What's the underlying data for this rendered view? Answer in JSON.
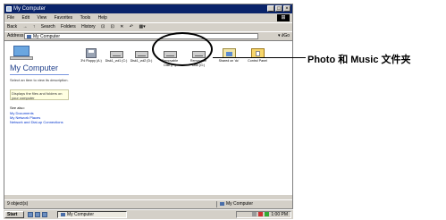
{
  "window": {
    "title": "My Computer",
    "controls": [
      "_",
      "□",
      "×"
    ],
    "menu": [
      "File",
      "Edit",
      "View",
      "Favorites",
      "Tools",
      "Help"
    ],
    "toolbar": [
      "Back",
      "→",
      "↑",
      "Search",
      "Folders",
      "History",
      "⊡",
      "⊡",
      "✕",
      "↶",
      "▦▾"
    ],
    "address_label": "Address",
    "address_value": "My Computer",
    "go_label": "▾ ∂Go"
  },
  "left_pane": {
    "title": "My Computer",
    "description": "Select an item to view its description.",
    "info": "Displays the files and folders on your computer",
    "see_also": "See also:",
    "links": [
      "My Documents",
      "My Network Places",
      "Network and Dial-up Connections"
    ]
  },
  "items": [
    {
      "label": "3½ Floppy (A:)",
      "icon": "floppy-icon"
    },
    {
      "label": "Disk1_vol1 (C:)",
      "icon": "drive-icon"
    },
    {
      "label": "Disk1_vol2 (D:)",
      "icon": "drive-icon"
    },
    {
      "label": "Removable Disk (F:)",
      "icon": "drive-icon"
    },
    {
      "label": "Removable Disk (G:)",
      "icon": "drive-icon"
    },
    {
      "label": "Shared on 'dc'",
      "icon": "network-share-icon"
    },
    {
      "label": "Control Panel",
      "icon": "control-panel-icon"
    }
  ],
  "status": {
    "left": "9 object(s)",
    "right": "My Computer"
  },
  "taskbar": {
    "start": "Start",
    "task": "My Computer",
    "clock": "1:00 PM"
  },
  "annotation": {
    "callout": "Photo 和 Music 文件夹"
  }
}
